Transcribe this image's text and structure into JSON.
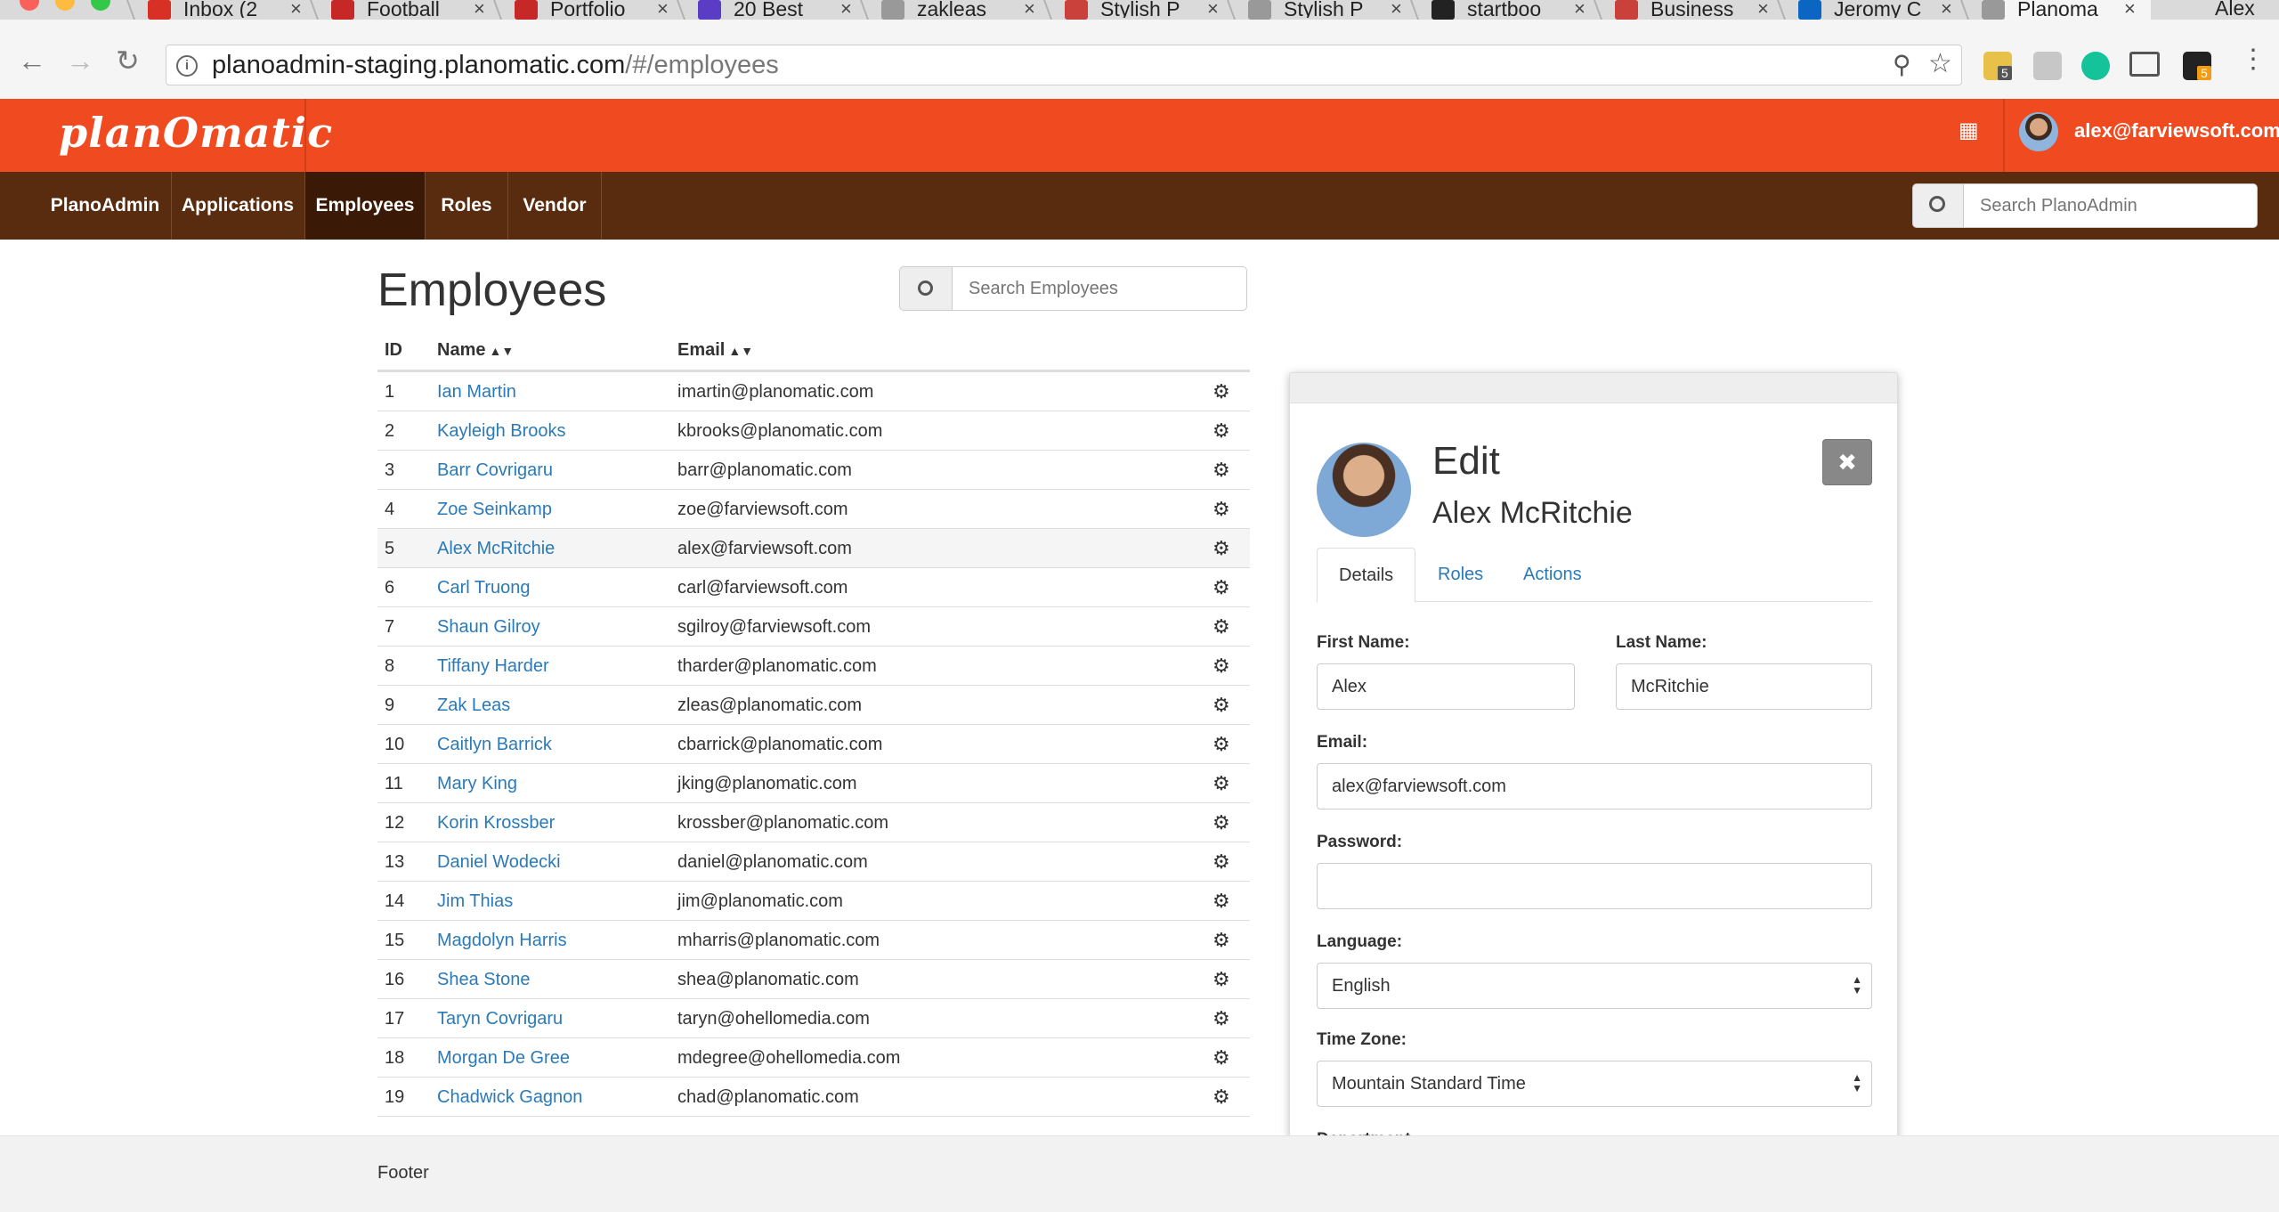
{
  "browser": {
    "tabs": [
      {
        "label": "Inbox (2",
        "favicon": "gmail-icon",
        "color": "#d93025"
      },
      {
        "label": "Football",
        "favicon": "b-icon",
        "color": "#c62828"
      },
      {
        "label": "Portfolio",
        "favicon": "rails-icon",
        "color": "#c62828"
      },
      {
        "label": "20 Best",
        "favicon": "colorlib-icon",
        "color": "#5b3cc4"
      },
      {
        "label": "zakleas",
        "favicon": "",
        "color": "#999999"
      },
      {
        "label": "Stylish P",
        "favicon": "s-icon",
        "color": "#c9413a"
      },
      {
        "label": "Stylish P",
        "favicon": "document-icon",
        "color": "#999999"
      },
      {
        "label": "startboo",
        "favicon": "github-icon",
        "color": "#222222"
      },
      {
        "label": "Business",
        "favicon": "s-icon",
        "color": "#c9413a"
      },
      {
        "label": "Jeromy C",
        "favicon": "linkedin-icon",
        "color": "#0a66c2"
      },
      {
        "label": "Planoma",
        "favicon": "document-icon",
        "color": "#999999"
      }
    ],
    "profile_name": "Alex",
    "url_host": "planoadmin-staging.planomatic.com",
    "url_path": "/#/employees",
    "ext_badge_1": "5",
    "ext_badge_2": "5"
  },
  "header": {
    "logo_text": "planOmatic",
    "user_email": "alex@farviewsoft.com",
    "brand_color": "#f04a21"
  },
  "nav": {
    "items": [
      {
        "label": "PlanoAdmin"
      },
      {
        "label": "Applications"
      },
      {
        "label": "Employees"
      },
      {
        "label": "Roles"
      },
      {
        "label": "Vendor"
      }
    ],
    "active": "Employees",
    "search_placeholder": "Search PlanoAdmin"
  },
  "main": {
    "title": "Employees",
    "search_placeholder": "Search Employees",
    "columns": {
      "id": "ID",
      "name": "Name",
      "email": "Email"
    },
    "rows": [
      {
        "id": "1",
        "name": "Ian Martin",
        "email": "imartin@planomatic.com"
      },
      {
        "id": "2",
        "name": "Kayleigh Brooks",
        "email": "kbrooks@planomatic.com"
      },
      {
        "id": "3",
        "name": "Barr Covrigaru",
        "email": "barr@planomatic.com"
      },
      {
        "id": "4",
        "name": "Zoe Seinkamp",
        "email": "zoe@farviewsoft.com"
      },
      {
        "id": "5",
        "name": "Alex McRitchie",
        "email": "alex@farviewsoft.com"
      },
      {
        "id": "6",
        "name": "Carl Truong",
        "email": "carl@farviewsoft.com"
      },
      {
        "id": "7",
        "name": "Shaun Gilroy",
        "email": "sgilroy@farviewsoft.com"
      },
      {
        "id": "8",
        "name": "Tiffany Harder",
        "email": "tharder@planomatic.com"
      },
      {
        "id": "9",
        "name": "Zak Leas",
        "email": "zleas@planomatic.com"
      },
      {
        "id": "10",
        "name": "Caitlyn Barrick",
        "email": "cbarrick@planomatic.com"
      },
      {
        "id": "11",
        "name": "Mary King",
        "email": "jking@planomatic.com"
      },
      {
        "id": "12",
        "name": "Korin Krossber",
        "email": "krossber@planomatic.com"
      },
      {
        "id": "13",
        "name": "Daniel Wodecki",
        "email": "daniel@planomatic.com"
      },
      {
        "id": "14",
        "name": "Jim Thias",
        "email": "jim@planomatic.com"
      },
      {
        "id": "15",
        "name": "Magdolyn Harris",
        "email": "mharris@planomatic.com"
      },
      {
        "id": "16",
        "name": "Shea Stone",
        "email": "shea@planomatic.com"
      },
      {
        "id": "17",
        "name": "Taryn Covrigaru",
        "email": "taryn@ohellomedia.com"
      },
      {
        "id": "18",
        "name": "Morgan De Gree",
        "email": "mdegree@ohellomedia.com"
      },
      {
        "id": "19",
        "name": "Chadwick Gagnon",
        "email": "chad@planomatic.com"
      }
    ],
    "highlighted_row": "5"
  },
  "edit_panel": {
    "heading": "Edit",
    "employee_name": "Alex McRitchie",
    "tabs": [
      {
        "label": "Details"
      },
      {
        "label": "Roles"
      },
      {
        "label": "Actions"
      }
    ],
    "active_tab": "Details",
    "first_name_label": "First Name:",
    "first_name_value": "Alex",
    "last_name_label": "Last Name:",
    "last_name_value": "McRitchie",
    "email_label": "Email:",
    "email_value": "alex@farviewsoft.com",
    "password_label": "Password:",
    "password_value": "",
    "language_label": "Language:",
    "language_value": "English",
    "timezone_label": "Time Zone:",
    "timezone_value": "Mountain Standard Time",
    "department_label": "Department:"
  },
  "footer": {
    "text": "Footer"
  }
}
